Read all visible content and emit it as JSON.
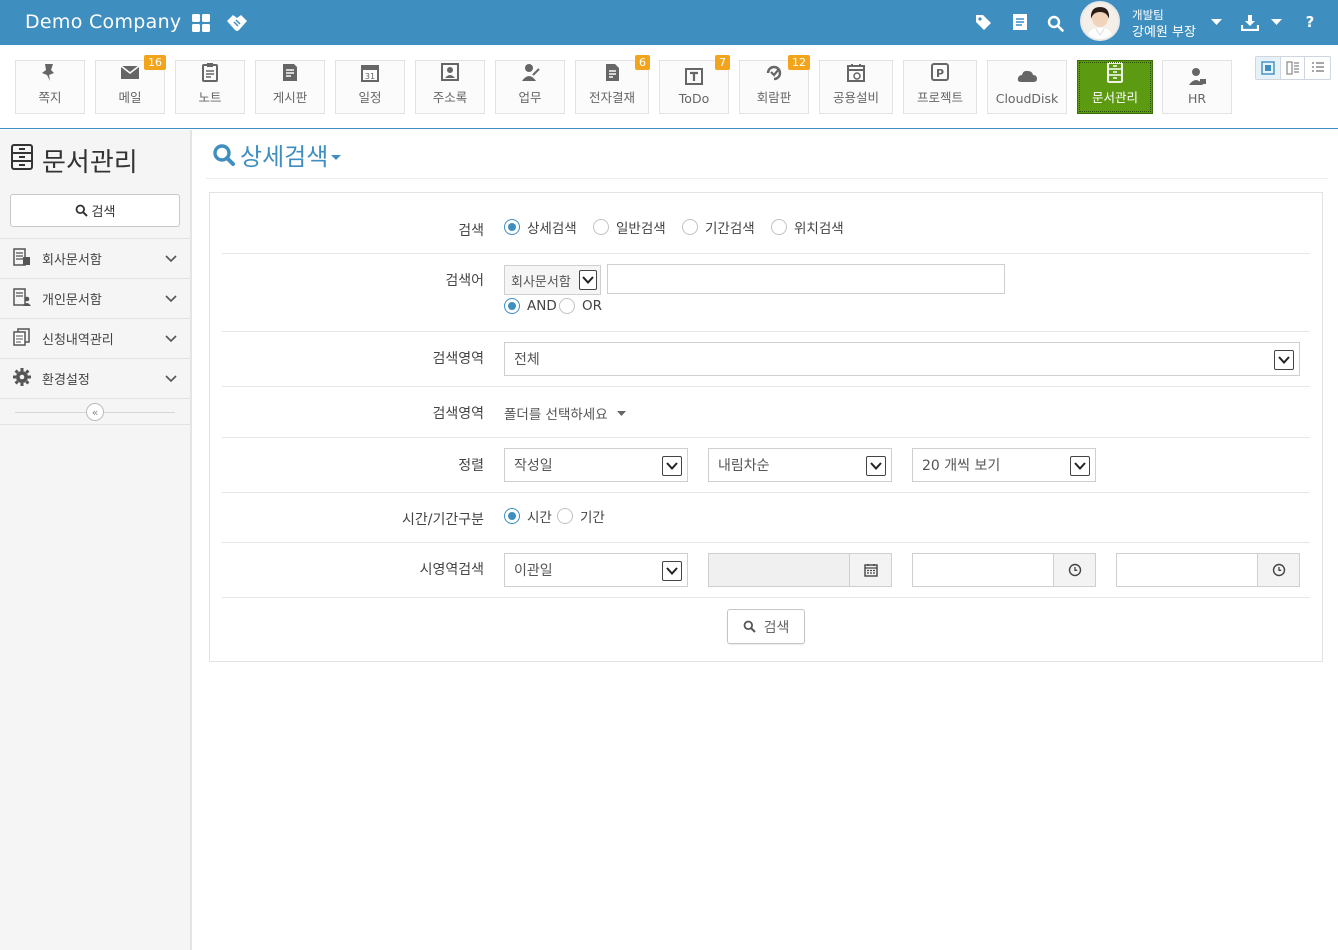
{
  "header": {
    "brand": "Demo Company",
    "user_team": "개발팀",
    "user_name": "강예원 부장",
    "help_label": "?"
  },
  "apps": [
    {
      "label": "쪽지",
      "badge": null,
      "icon": "pin-icon"
    },
    {
      "label": "메일",
      "badge": "16",
      "icon": "mail-icon"
    },
    {
      "label": "노트",
      "badge": null,
      "icon": "clipboard-icon"
    },
    {
      "label": "게시판",
      "badge": null,
      "icon": "board-icon"
    },
    {
      "label": "일정",
      "badge": null,
      "icon": "calendar-icon"
    },
    {
      "label": "주소록",
      "badge": null,
      "icon": "contact-card-icon"
    },
    {
      "label": "업무",
      "badge": null,
      "icon": "task-person-icon"
    },
    {
      "label": "전자결재",
      "badge": "6",
      "icon": "approval-document-icon"
    },
    {
      "label": "ToDo",
      "badge": "7",
      "icon": "todo-icon"
    },
    {
      "label": "회람판",
      "badge": "12",
      "icon": "circular-icon"
    },
    {
      "label": "공용설비",
      "badge": null,
      "icon": "facility-calendar-icon"
    },
    {
      "label": "프로젝트",
      "badge": null,
      "icon": "project-icon"
    },
    {
      "label": "CloudDisk",
      "badge": null,
      "icon": "cloud-disk-icon"
    },
    {
      "label": "문서관리",
      "badge": null,
      "icon": "document-cabinet-icon",
      "active": true
    },
    {
      "label": "HR",
      "badge": null,
      "icon": "hr-person-icon"
    }
  ],
  "sidebar": {
    "title": "문서관리",
    "search_label": "검색",
    "items": [
      {
        "label": "회사문서함"
      },
      {
        "label": "개인문서함"
      },
      {
        "label": "신청내역관리"
      },
      {
        "label": "환경설정"
      }
    ],
    "collapse_label": "«"
  },
  "main": {
    "title": "상세검색",
    "search_type": {
      "label": "검색",
      "options": [
        "상세검색",
        "일반검색",
        "기간검색",
        "위치검색"
      ],
      "selected": "상세검색"
    },
    "keyword": {
      "label": "검색어",
      "scope_value": "회사문서함",
      "value": "",
      "logic_options": [
        "AND",
        "OR"
      ],
      "logic_selected": "AND"
    },
    "area": {
      "label": "검색영역",
      "value": "전체"
    },
    "folder": {
      "label": "검색영역",
      "value": "폴더를 선택하세요"
    },
    "sort": {
      "label": "정렬",
      "field": "작성일",
      "order": "내림차순",
      "page_size": "20 개씩 보기"
    },
    "time_mode": {
      "label": "시간/기간구분",
      "options": [
        "시간",
        "기간"
      ],
      "selected": "시간"
    },
    "time_search": {
      "label": "시영역검색",
      "value": "이관일",
      "date_value": "",
      "time_from": "",
      "time_to": ""
    },
    "search_button": "검색"
  },
  "colors": {
    "header_bg": "#3f8ec0",
    "active_app_bg": "#5c9a12",
    "badge_bg": "#f2a51c",
    "accent": "#3f8ec0"
  }
}
